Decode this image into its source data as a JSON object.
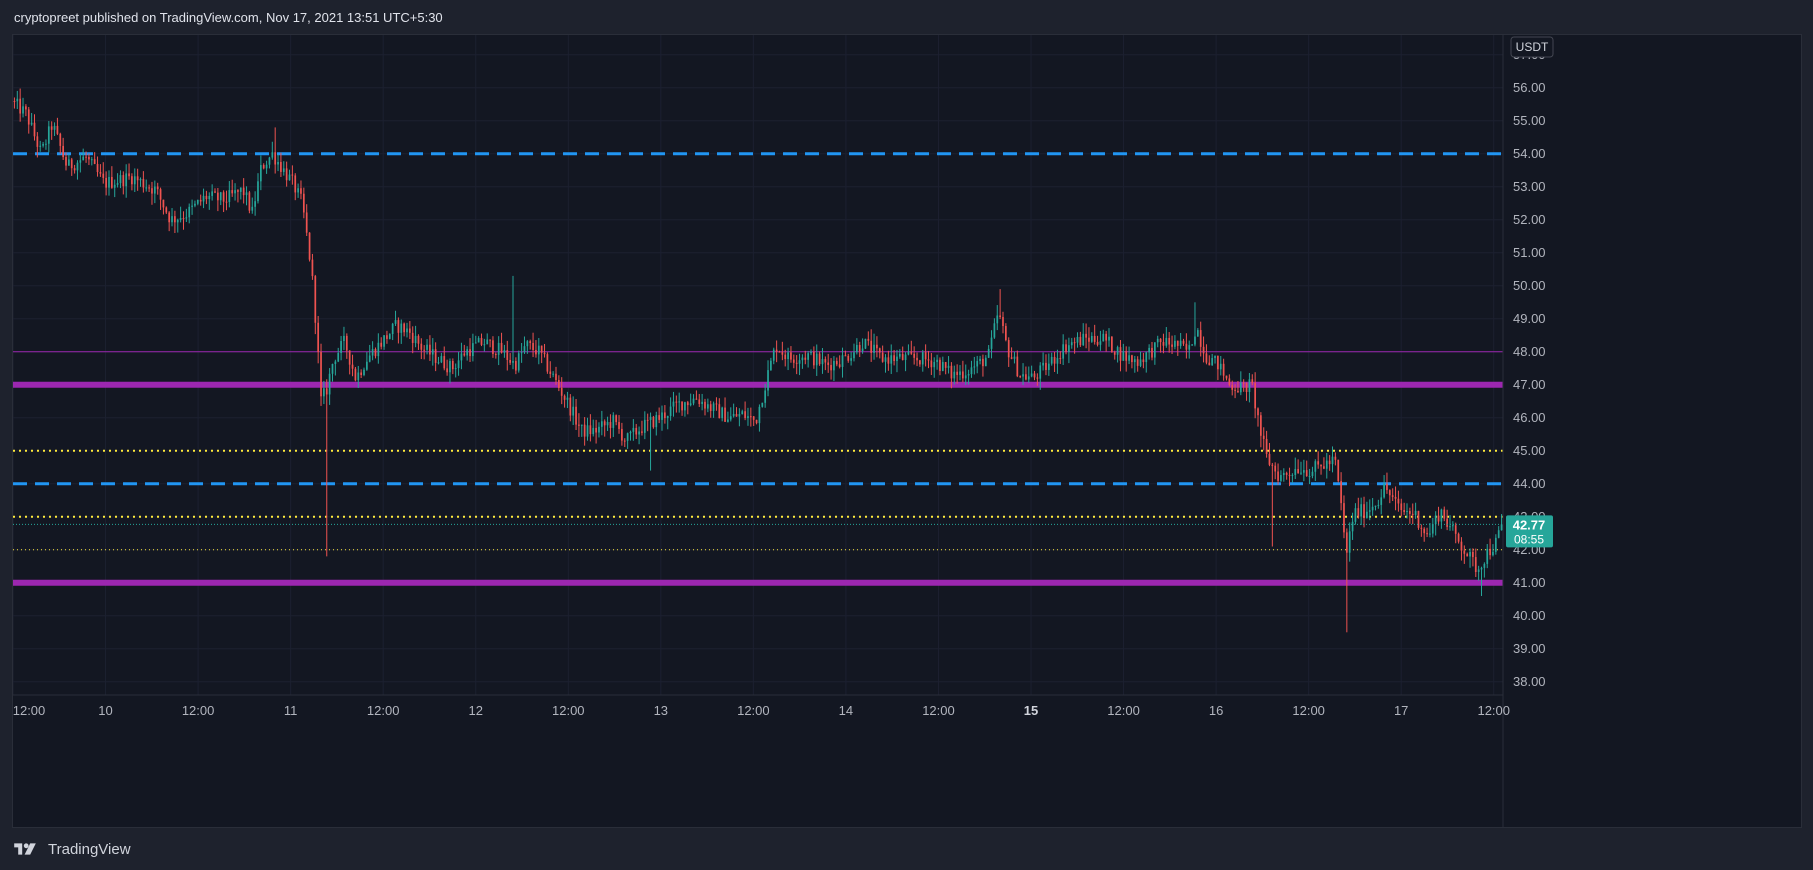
{
  "header": {
    "published_text": "cryptopreet published on TradingView.com, Nov 17, 2021 13:51 UTC+5:30"
  },
  "footer": {
    "brand": "TradingView",
    "logo_icon": "tradingview-logo-icon"
  },
  "colors": {
    "background": "#131722",
    "grid": "#1e222d",
    "up": "#26a69a",
    "down": "#ef5350",
    "magenta": "#9c27b0",
    "blue": "#2196f3",
    "yellow": "#ffeb3b",
    "price_tag": "#26a69a"
  },
  "chart_data": {
    "type": "candlestick",
    "quote_currency": "USDT",
    "y_axis": {
      "min": 37.6,
      "max": 57.6,
      "ticks": [
        "57.00",
        "56.00",
        "55.00",
        "54.00",
        "53.00",
        "52.00",
        "51.00",
        "50.00",
        "49.00",
        "48.00",
        "47.00",
        "46.00",
        "45.00",
        "44.00",
        "43.00",
        "42.00",
        "41.00",
        "40.00",
        "39.00",
        "38.00"
      ],
      "tick_values": [
        57,
        56,
        55,
        54,
        53,
        52,
        51,
        50,
        49,
        48,
        47,
        46,
        45,
        44,
        43,
        42,
        41,
        40,
        39,
        38
      ]
    },
    "x_axis": {
      "ticks": [
        {
          "label": "12:00",
          "t": 0.0
        },
        {
          "label": "10",
          "t": 0.5
        },
        {
          "label": "12:00",
          "t": 1.0
        },
        {
          "label": "11",
          "t": 1.5
        },
        {
          "label": "12:00",
          "t": 2.0
        },
        {
          "label": "12",
          "t": 2.5
        },
        {
          "label": "12:00",
          "t": 3.0
        },
        {
          "label": "13",
          "t": 3.5
        },
        {
          "label": "12:00",
          "t": 4.0
        },
        {
          "label": "14",
          "t": 4.5
        },
        {
          "label": "12:00",
          "t": 5.0
        },
        {
          "label": "15",
          "t": 5.5,
          "bold": true
        },
        {
          "label": "12:00",
          "t": 6.0
        },
        {
          "label": "16",
          "t": 6.5
        },
        {
          "label": "12:00",
          "t": 7.0
        },
        {
          "label": "17",
          "t": 7.5
        },
        {
          "label": "12:00",
          "t": 8.0
        }
      ],
      "t_min": 0.0,
      "t_max": 8.05
    },
    "horizontal_lines": [
      {
        "price": 54.0,
        "color": "#2196f3",
        "style": "dashed",
        "width": 3
      },
      {
        "price": 48.0,
        "color": "#9c27b0",
        "style": "solid",
        "width": 1
      },
      {
        "price": 47.0,
        "color": "#9c27b0",
        "style": "solid",
        "width": 6
      },
      {
        "price": 45.0,
        "color": "#ffeb3b",
        "style": "dotted",
        "width": 2
      },
      {
        "price": 44.0,
        "color": "#2196f3",
        "style": "dashed",
        "width": 3
      },
      {
        "price": 43.0,
        "color": "#ffeb3b",
        "style": "dotted",
        "width": 2
      },
      {
        "price": 42.0,
        "color": "#ffeb3b",
        "style": "dotted",
        "width": 1
      },
      {
        "price": 41.0,
        "color": "#9c27b0",
        "style": "solid",
        "width": 6
      }
    ],
    "last_price": {
      "value": 42.77,
      "label": "42.77",
      "countdown": "08:55"
    },
    "price_path": [
      {
        "t": 0.0,
        "p": 55.6
      },
      {
        "t": 0.08,
        "p": 55.2
      },
      {
        "t": 0.16,
        "p": 54.0
      },
      {
        "t": 0.22,
        "p": 54.9
      },
      {
        "t": 0.3,
        "p": 53.6
      },
      {
        "t": 0.4,
        "p": 53.9
      },
      {
        "t": 0.5,
        "p": 53.1
      },
      {
        "t": 0.65,
        "p": 53.3
      },
      {
        "t": 0.78,
        "p": 52.9
      },
      {
        "t": 0.86,
        "p": 52.0
      },
      {
        "t": 0.95,
        "p": 52.2
      },
      {
        "t": 1.05,
        "p": 52.7
      },
      {
        "t": 1.15,
        "p": 52.6
      },
      {
        "t": 1.25,
        "p": 52.9
      },
      {
        "t": 1.3,
        "p": 52.2
      },
      {
        "t": 1.35,
        "p": 53.6
      },
      {
        "t": 1.41,
        "p": 54.0
      },
      {
        "t": 1.47,
        "p": 53.5
      },
      {
        "t": 1.52,
        "p": 53.1
      },
      {
        "t": 1.57,
        "p": 52.5
      },
      {
        "t": 1.62,
        "p": 50.5
      },
      {
        "t": 1.65,
        "p": 48.5
      },
      {
        "t": 1.67,
        "p": 46.5
      },
      {
        "t": 1.7,
        "p": 46.8
      },
      {
        "t": 1.74,
        "p": 47.8
      },
      {
        "t": 1.8,
        "p": 48.3
      },
      {
        "t": 1.86,
        "p": 47.2
      },
      {
        "t": 1.92,
        "p": 47.8
      },
      {
        "t": 2.0,
        "p": 48.3
      },
      {
        "t": 2.08,
        "p": 48.8
      },
      {
        "t": 2.15,
        "p": 48.6
      },
      {
        "t": 2.22,
        "p": 48.1
      },
      {
        "t": 2.3,
        "p": 47.8
      },
      {
        "t": 2.38,
        "p": 47.5
      },
      {
        "t": 2.45,
        "p": 48.0
      },
      {
        "t": 2.55,
        "p": 48.3
      },
      {
        "t": 2.65,
        "p": 48.0
      },
      {
        "t": 2.72,
        "p": 47.6
      },
      {
        "t": 2.78,
        "p": 48.2
      },
      {
        "t": 2.85,
        "p": 48.0
      },
      {
        "t": 2.92,
        "p": 47.3
      },
      {
        "t": 3.0,
        "p": 46.5
      },
      {
        "t": 3.08,
        "p": 45.6
      },
      {
        "t": 3.15,
        "p": 45.6
      },
      {
        "t": 3.25,
        "p": 45.9
      },
      {
        "t": 3.32,
        "p": 45.3
      },
      {
        "t": 3.4,
        "p": 45.7
      },
      {
        "t": 3.5,
        "p": 46.0
      },
      {
        "t": 3.6,
        "p": 46.4
      },
      {
        "t": 3.7,
        "p": 46.6
      },
      {
        "t": 3.78,
        "p": 46.3
      },
      {
        "t": 3.88,
        "p": 46.0
      },
      {
        "t": 3.95,
        "p": 46.1
      },
      {
        "t": 4.02,
        "p": 45.9
      },
      {
        "t": 4.08,
        "p": 47.2
      },
      {
        "t": 4.13,
        "p": 48.2
      },
      {
        "t": 4.2,
        "p": 47.8
      },
      {
        "t": 4.3,
        "p": 47.9
      },
      {
        "t": 4.4,
        "p": 47.6
      },
      {
        "t": 4.5,
        "p": 47.8
      },
      {
        "t": 4.6,
        "p": 48.3
      },
      {
        "t": 4.7,
        "p": 47.8
      },
      {
        "t": 4.8,
        "p": 47.8
      },
      {
        "t": 4.9,
        "p": 47.8
      },
      {
        "t": 5.0,
        "p": 47.7
      },
      {
        "t": 5.08,
        "p": 47.3
      },
      {
        "t": 5.15,
        "p": 47.4
      },
      {
        "t": 5.22,
        "p": 47.6
      },
      {
        "t": 5.28,
        "p": 47.9
      },
      {
        "t": 5.33,
        "p": 49.2
      },
      {
        "t": 5.38,
        "p": 48.1
      },
      {
        "t": 5.45,
        "p": 47.3
      },
      {
        "t": 5.52,
        "p": 47.2
      },
      {
        "t": 5.6,
        "p": 47.6
      },
      {
        "t": 5.7,
        "p": 48.2
      },
      {
        "t": 5.8,
        "p": 48.4
      },
      {
        "t": 5.9,
        "p": 48.4
      },
      {
        "t": 6.0,
        "p": 47.9
      },
      {
        "t": 6.08,
        "p": 47.7
      },
      {
        "t": 6.15,
        "p": 48.0
      },
      {
        "t": 6.22,
        "p": 48.3
      },
      {
        "t": 6.3,
        "p": 48.2
      },
      {
        "t": 6.36,
        "p": 48.0
      },
      {
        "t": 6.4,
        "p": 48.8
      },
      {
        "t": 6.45,
        "p": 47.9
      },
      {
        "t": 6.52,
        "p": 47.6
      },
      {
        "t": 6.58,
        "p": 47.0
      },
      {
        "t": 6.65,
        "p": 46.9
      },
      {
        "t": 6.7,
        "p": 47.0
      },
      {
        "t": 6.75,
        "p": 45.5
      },
      {
        "t": 6.78,
        "p": 44.8
      },
      {
        "t": 6.85,
        "p": 44.2
      },
      {
        "t": 6.95,
        "p": 44.5
      },
      {
        "t": 7.02,
        "p": 44.4
      },
      {
        "t": 7.1,
        "p": 44.6
      },
      {
        "t": 7.15,
        "p": 44.7
      },
      {
        "t": 7.18,
        "p": 43.5
      },
      {
        "t": 7.21,
        "p": 41.8
      },
      {
        "t": 7.25,
        "p": 43.1
      },
      {
        "t": 7.32,
        "p": 43.2
      },
      {
        "t": 7.38,
        "p": 43.5
      },
      {
        "t": 7.42,
        "p": 43.9
      },
      {
        "t": 7.5,
        "p": 43.2
      },
      {
        "t": 7.58,
        "p": 43.1
      },
      {
        "t": 7.65,
        "p": 42.4
      },
      {
        "t": 7.72,
        "p": 43.2
      },
      {
        "t": 7.78,
        "p": 42.6
      },
      {
        "t": 7.85,
        "p": 42.0
      },
      {
        "t": 7.92,
        "p": 41.4
      },
      {
        "t": 7.97,
        "p": 41.9
      },
      {
        "t": 8.02,
        "p": 42.2
      },
      {
        "t": 8.05,
        "p": 42.77
      }
    ],
    "extreme_wicks": [
      {
        "t": 1.69,
        "low": 41.8
      },
      {
        "t": 2.7,
        "high": 50.3
      },
      {
        "t": 3.45,
        "low": 44.4
      },
      {
        "t": 5.33,
        "high": 49.9
      },
      {
        "t": 6.38,
        "high": 49.5
      },
      {
        "t": 6.8,
        "low": 42.1
      },
      {
        "t": 7.21,
        "low": 39.5
      },
      {
        "t": 7.93,
        "low": 40.6
      },
      {
        "t": 1.41,
        "high": 54.8
      }
    ]
  }
}
